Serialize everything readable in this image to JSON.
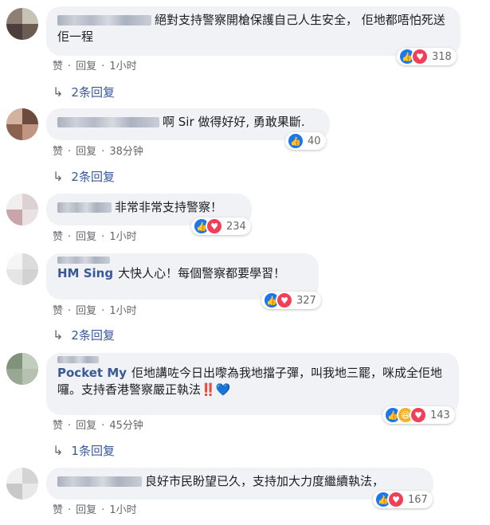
{
  "comments": [
    {
      "name": "",
      "text": "絕對支持警察開槍保護自己人生安全， 佢地都唔怕死送佢一程",
      "reactions": [
        "like",
        "love"
      ],
      "reaction_count": "318",
      "like": "赞",
      "reply": "回复",
      "time": "1小时",
      "replies": "2条回复"
    },
    {
      "name": "",
      "text": "啊 Sir 做得好好, 勇敢果斷.",
      "reactions": [
        "like"
      ],
      "reaction_count": "40",
      "like": "赞",
      "reply": "回复",
      "time": "38分钟",
      "replies": "2条回复"
    },
    {
      "name": "",
      "text": "非常非常支持警察！",
      "reactions": [
        "like",
        "love"
      ],
      "reaction_count": "234",
      "like": "赞",
      "reply": "回复",
      "time": "1小时",
      "replies": ""
    },
    {
      "name": "HM Sing",
      "text": "大快人心！每個警察都要學習！",
      "reactions": [
        "like",
        "love"
      ],
      "reaction_count": "327",
      "like": "赞",
      "reply": "回复",
      "time": "1小时",
      "replies": "2条回复"
    },
    {
      "name": "Pocket My",
      "text": "佢地講咗今日出嚟為我地擋子彈，叫我地三罷，咪成全佢地囉。支持香港警察嚴正執法‼️💙",
      "reactions": [
        "like",
        "haha",
        "love"
      ],
      "reaction_count": "143",
      "like": "赞",
      "reply": "回复",
      "time": "45分钟",
      "replies": "1条回复"
    },
    {
      "name": "",
      "text": "良好市民盼望已久，支持加大力度繼續執法，",
      "reactions": [
        "like",
        "love"
      ],
      "reaction_count": "167",
      "like": "赞",
      "reply": "回复",
      "time": "1小时",
      "replies": ""
    }
  ],
  "colors": {
    "bubble": "#f0f2f5",
    "name": "#385898",
    "like": "#1877f2",
    "love": "#f33e58",
    "haha": "#f7b125"
  },
  "icons": {
    "like": "thumbs-up-icon",
    "love": "heart-icon",
    "haha": "laughing-face-icon",
    "reply_arrow": "reply-arrow-icon"
  }
}
